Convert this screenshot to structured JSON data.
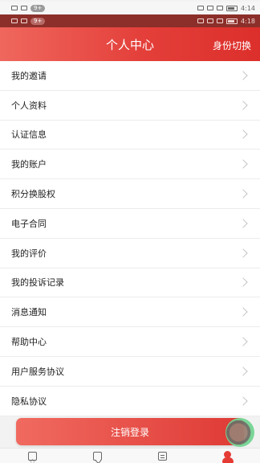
{
  "status_bar_top": {
    "notification_badge": "9+",
    "time": "4:14",
    "battery_icon": "battery-icon"
  },
  "status_bar_second": {
    "notification_badge": "9+",
    "time": "4:18",
    "battery_icon": "battery-icon"
  },
  "header": {
    "title": "个人中心",
    "action_label": "身份切换"
  },
  "menu": {
    "items": [
      {
        "label": "我的邀请"
      },
      {
        "label": "个人资料"
      },
      {
        "label": "认证信息"
      },
      {
        "label": "我的账户"
      },
      {
        "label": "积分换股权"
      },
      {
        "label": "电子合同"
      },
      {
        "label": "我的评价"
      },
      {
        "label": "我的投诉记录"
      },
      {
        "label": "消息通知"
      },
      {
        "label": "帮助中心"
      },
      {
        "label": "用户服务协议"
      },
      {
        "label": "隐私协议"
      }
    ]
  },
  "logout": {
    "label": "注销登录"
  },
  "bottom_nav": {
    "items": [
      {
        "icon": "star-icon",
        "active": false
      },
      {
        "icon": "chat-icon",
        "active": false
      },
      {
        "icon": "document-icon",
        "active": false
      },
      {
        "icon": "user-icon",
        "active": true
      }
    ]
  },
  "colors": {
    "brand_red": "#e43f3a",
    "header_gradient_start": "#ef675d",
    "header_gradient_end": "#dc2f2b",
    "text_primary": "#222222",
    "divider": "#ececec"
  }
}
